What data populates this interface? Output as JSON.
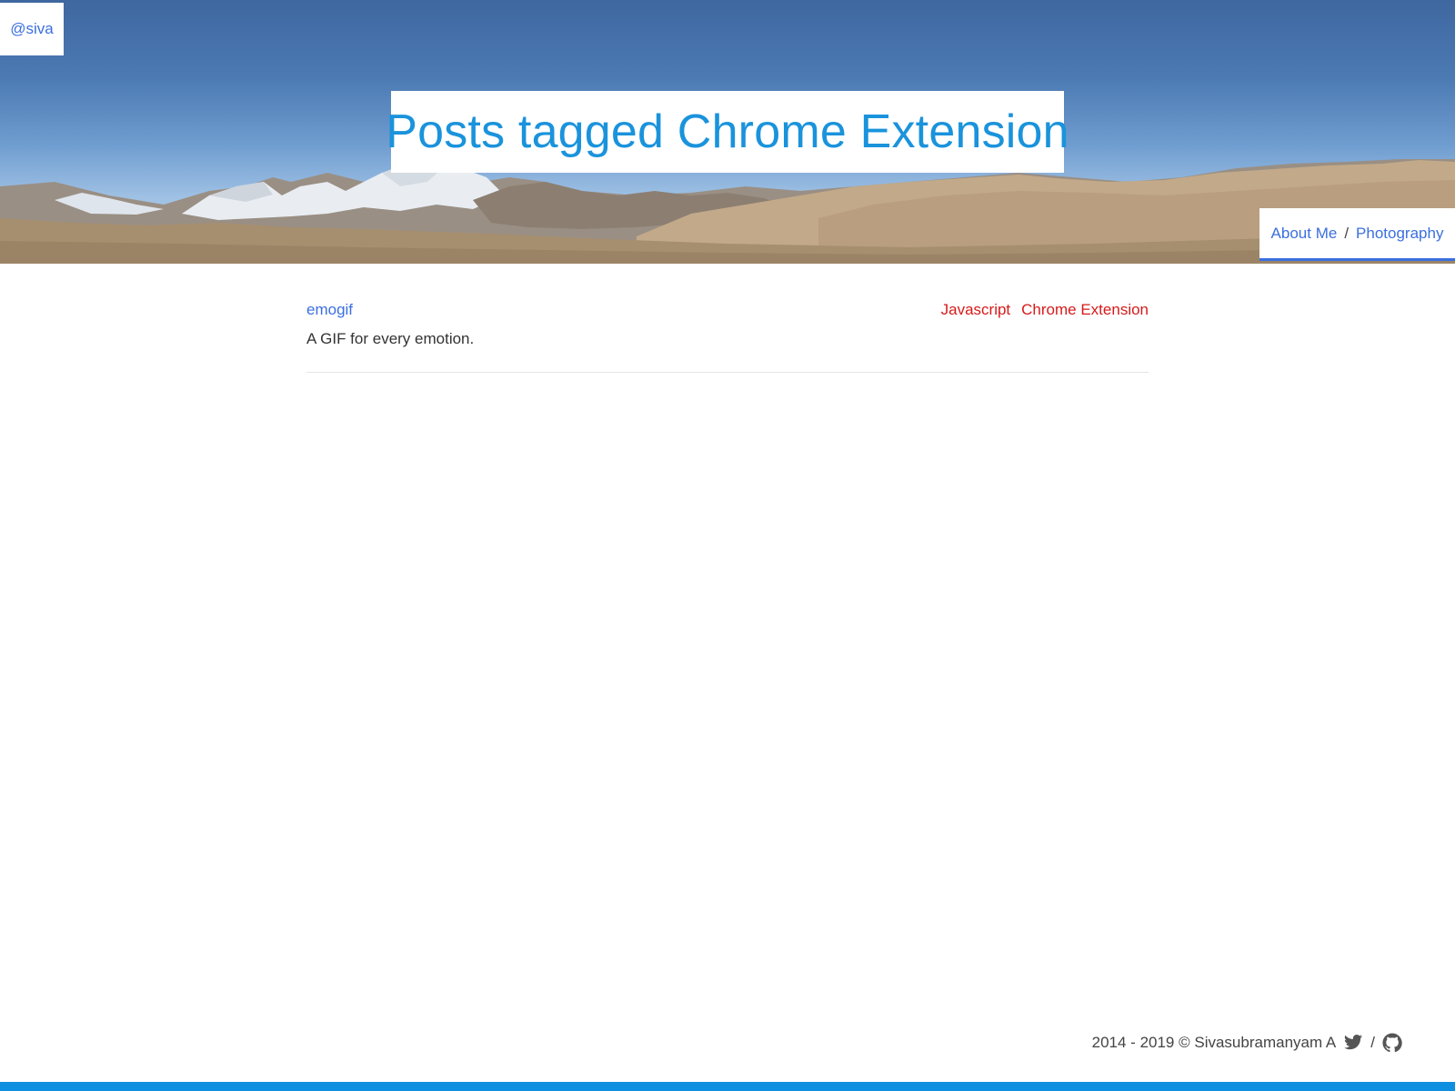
{
  "header": {
    "handle": "@siva",
    "title": "Posts tagged Chrome Extension",
    "nav": {
      "about": "About Me",
      "separator": "/",
      "photography": "Photography"
    }
  },
  "posts": [
    {
      "title": "emogif",
      "description": "A GIF for every emotion.",
      "tags": [
        "Javascript",
        "Chrome Extension"
      ]
    }
  ],
  "footer": {
    "copyright": "2014 - 2019 © Sivasubramanyam A",
    "separator": "/",
    "icons": [
      "twitter-icon",
      "github-icon"
    ]
  },
  "colors": {
    "link": "#3b6fe0",
    "title": "#1a93dc",
    "tag": "#d61a1a",
    "bottom_bar": "#0f8fe0"
  }
}
